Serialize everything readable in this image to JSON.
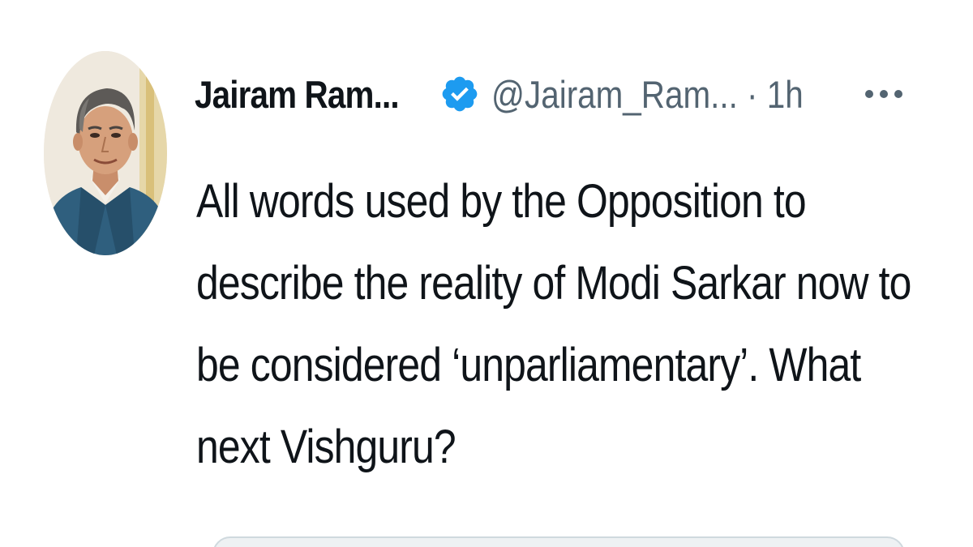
{
  "tweet": {
    "author": {
      "display_name": "Jairam Ram...",
      "handle": "@Jairam_Ram...",
      "verified_icon": "verified-badge-icon",
      "avatar_icon": "profile-photo"
    },
    "separator": "·",
    "timestamp": "1h",
    "more_icon": "more-options-icon",
    "text_lines": [
      "All words used by the Opposition to",
      "describe the reality of Modi Sarkar now to",
      "be considered ‘unparliamentary’. What",
      "next Vishguru?"
    ]
  },
  "colors": {
    "verified_blue": "#1d9bf0",
    "text": "#0f1419",
    "secondary_text": "#536471"
  }
}
